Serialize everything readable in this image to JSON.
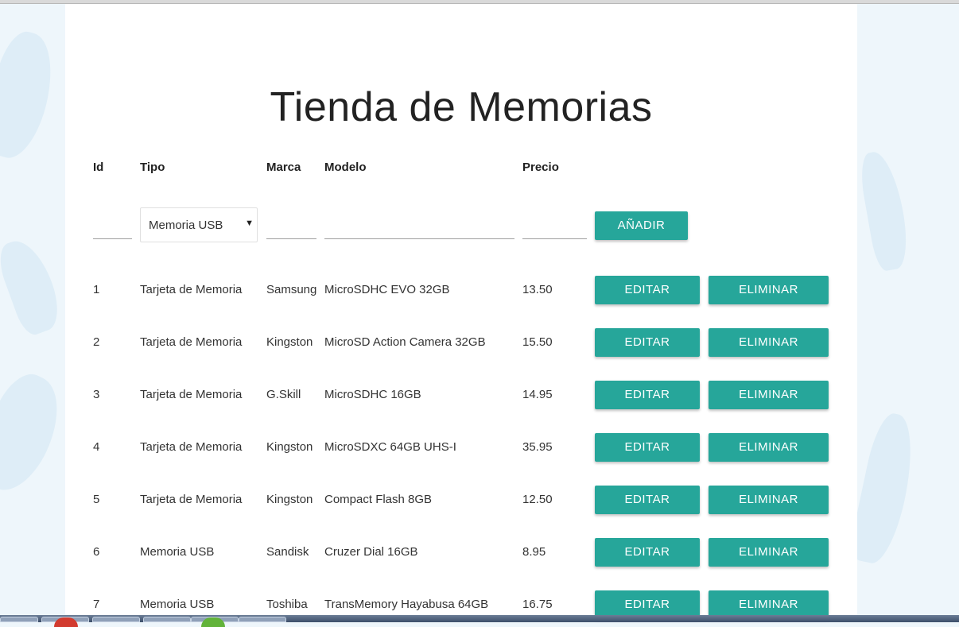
{
  "title": "Tienda de Memorias",
  "headers": {
    "id": "Id",
    "tipo": "Tipo",
    "marca": "Marca",
    "modelo": "Modelo",
    "precio": "Precio"
  },
  "form": {
    "id_value": "",
    "tipo_selected": "Memoria USB",
    "marca_value": "",
    "modelo_value": "",
    "precio_value": "",
    "add_label": "AÑADIR"
  },
  "actions": {
    "edit_label": "EDITAR",
    "delete_label": "ELIMINAR"
  },
  "rows": [
    {
      "id": "1",
      "tipo": "Tarjeta de Memoria",
      "marca": "Samsung",
      "modelo": "MicroSDHC EVO 32GB",
      "precio": "13.50"
    },
    {
      "id": "2",
      "tipo": "Tarjeta de Memoria",
      "marca": "Kingston",
      "modelo": "MicroSD Action Camera 32GB",
      "precio": "15.50"
    },
    {
      "id": "3",
      "tipo": "Tarjeta de Memoria",
      "marca": "G.Skill",
      "modelo": "MicroSDHC 16GB",
      "precio": "14.95"
    },
    {
      "id": "4",
      "tipo": "Tarjeta de Memoria",
      "marca": "Kingston",
      "modelo": "MicroSDXC 64GB UHS-I",
      "precio": "35.95"
    },
    {
      "id": "5",
      "tipo": "Tarjeta de Memoria",
      "marca": "Kingston",
      "modelo": "Compact Flash 8GB",
      "precio": "12.50"
    },
    {
      "id": "6",
      "tipo": "Memoria USB",
      "marca": "Sandisk",
      "modelo": "Cruzer Dial 16GB",
      "precio": "8.95"
    },
    {
      "id": "7",
      "tipo": "Memoria USB",
      "marca": "Toshiba",
      "modelo": "TransMemory Hayabusa 64GB",
      "precio": "16.75"
    }
  ],
  "colors": {
    "accent": "#26a69a",
    "background": "#eef6fb",
    "card": "#ffffff"
  }
}
